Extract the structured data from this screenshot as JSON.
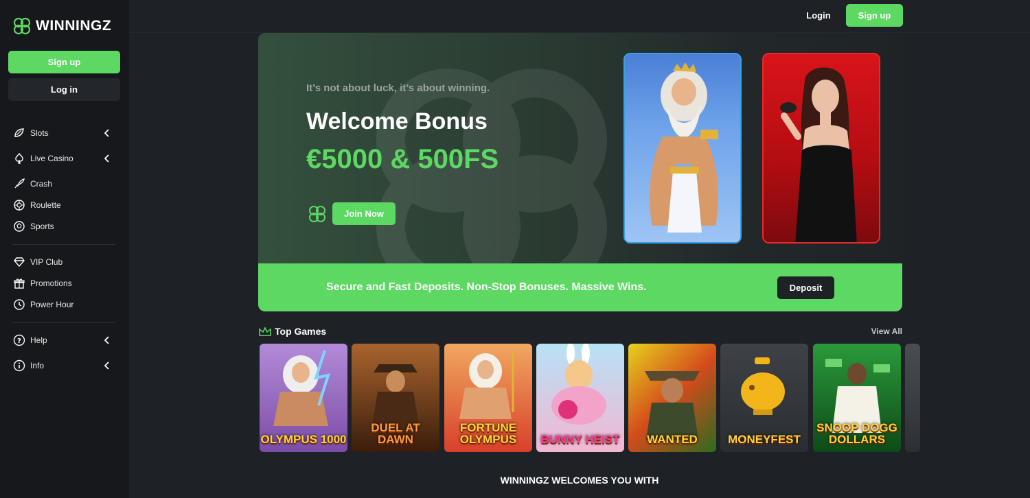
{
  "brand": {
    "name": "WINNINGZ",
    "accent": "#5cd863"
  },
  "sidebar": {
    "signup_label": "Sign up",
    "login_label": "Log in",
    "items": [
      {
        "label": "Slots",
        "icon": "slots-icon",
        "expandable": true
      },
      {
        "label": "Live Casino",
        "icon": "spade-icon",
        "expandable": true
      },
      {
        "label": "Crash",
        "icon": "rocket-icon",
        "expandable": false
      },
      {
        "label": "Roulette",
        "icon": "roulette-icon",
        "expandable": false
      },
      {
        "label": "Sports",
        "icon": "ball-icon",
        "expandable": false
      },
      {
        "label": "VIP Club",
        "icon": "diamond-icon",
        "expandable": false
      },
      {
        "label": "Promotions",
        "icon": "gift-icon",
        "expandable": false
      },
      {
        "label": "Power Hour",
        "icon": "clock-icon",
        "expandable": false
      },
      {
        "label": "Help",
        "icon": "help-icon",
        "expandable": true
      },
      {
        "label": "Info",
        "icon": "info-icon",
        "expandable": true
      }
    ]
  },
  "header": {
    "login_label": "Login",
    "signup_label": "Sign up"
  },
  "hero": {
    "tagline": "It’s not about luck, it’s about winning.",
    "title": "Welcome Bonus",
    "amount": "€5000 & 500FS",
    "join_label": "Join Now"
  },
  "promo": {
    "text": "Secure and Fast Deposits. Non-Stop Bonuses. Massive Wins.",
    "deposit_label": "Deposit"
  },
  "top_games": {
    "title": "Top Games",
    "view_all": "View All",
    "games": [
      {
        "label": "OLYMPUS 1000",
        "bg": "#8a5bb8"
      },
      {
        "label": "DUEL AT DAWN",
        "bg": "#6b3a1c"
      },
      {
        "label": "FORTUNE OLYMPUS",
        "bg": "#d9612a"
      },
      {
        "label": "BUNNY HEIST",
        "bg": "#e8a8c8"
      },
      {
        "label": "WANTED",
        "bg": "#d8b020"
      },
      {
        "label": "MONEYFEST",
        "bg": "#3b3f44"
      },
      {
        "label": "SNOOP DOGG DOLLARS",
        "bg": "#1f7d2a"
      }
    ]
  },
  "footer_heading": "WINNINGZ WELCOMES YOU WITH"
}
